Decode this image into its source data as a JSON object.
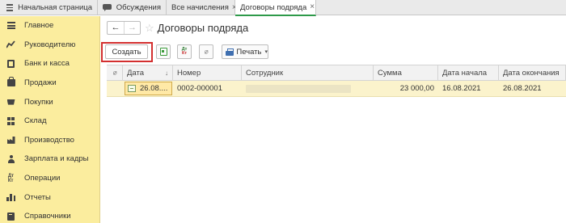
{
  "tabs": [
    {
      "label": "Начальная страница"
    },
    {
      "label": "Обсуждения"
    },
    {
      "label": "Все начисления",
      "close": "×"
    },
    {
      "label": "Договоры подряда",
      "close": "×"
    }
  ],
  "sidebar": {
    "items": [
      {
        "label": "Главное",
        "icon": "menu-icon"
      },
      {
        "label": "Руководителю",
        "icon": "chart-icon"
      },
      {
        "label": "Банк и касса",
        "icon": "bank-icon"
      },
      {
        "label": "Продажи",
        "icon": "bag-icon"
      },
      {
        "label": "Покупки",
        "icon": "cart-icon"
      },
      {
        "label": "Склад",
        "icon": "warehouse-icon"
      },
      {
        "label": "Производство",
        "icon": "factory-icon"
      },
      {
        "label": "Зарплата и кадры",
        "icon": "user-icon"
      },
      {
        "label": "Операции",
        "icon": "operations-icon"
      },
      {
        "label": "Отчеты",
        "icon": "reports-icon"
      },
      {
        "label": "Справочники",
        "icon": "book-icon"
      }
    ]
  },
  "header": {
    "back": "←",
    "forward": "→",
    "star": "☆",
    "title": "Договоры подряда"
  },
  "toolbar": {
    "create_label": "Создать",
    "dtkt_top": "Дт",
    "dtkt_bottom": "Кт",
    "print_label": "Печать",
    "caret": "▾",
    "highlight_color": "#d32f2f"
  },
  "table": {
    "columns": [
      "Дата",
      "Номер",
      "Сотрудник",
      "Сумма",
      "Дата начала",
      "Дата окончания"
    ],
    "sort_indicator": "↓",
    "rows": [
      {
        "date": "26.08....",
        "number": "0002-000001",
        "employee": "",
        "sum": "23 000,00",
        "start": "16.08.2021",
        "end": "26.08.2021"
      }
    ]
  },
  "colors": {
    "sidebar_bg": "#fbed9e",
    "active_tab_underline": "#2e9a4a",
    "selected_row": "#fbf3cc"
  }
}
